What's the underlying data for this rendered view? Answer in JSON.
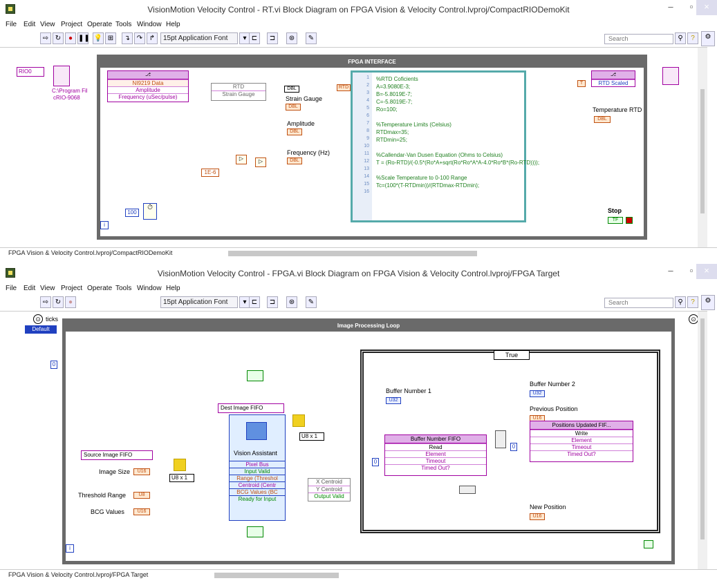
{
  "window1": {
    "title": "VisionMotion Velocity Control - RT.vi Block Diagram on FPGA Vision & Velocity Control.lvproj/CompactRIODemoKit",
    "menu": [
      "File",
      "Edit",
      "View",
      "Project",
      "Operate",
      "Tools",
      "Window",
      "Help"
    ],
    "font_select": "15pt Application Font",
    "search_placeholder": "Search",
    "status": "FPGA Vision & Velocity Control.lvproj/CompactRIODemoKit",
    "loop_title": "FPGA INTERFACE",
    "rio_label": "RIO0",
    "rio_path": "C:\\Program Fil",
    "rio_device": "cRIO-9068",
    "read_node": {
      "items": [
        "NI9219 Data",
        "Amplitude",
        "Frequency (uSec/pulse)"
      ]
    },
    "unbundle": {
      "items": [
        "RTD",
        "Strain Gauge"
      ]
    },
    "outputs": {
      "dbl": "DBL",
      "strain_gauge": "Strain Gauge",
      "amplitude": "Amplitude",
      "frequency": "Frequency (Hz)",
      "const": "1E-6",
      "wait": "100",
      "rtd": "RTD"
    },
    "code_lines": [
      "%RTD Coficients",
      "A=3.9080E-3;",
      "B=-5.8019E-7;",
      "C=-5.8019E-7;",
      "Ro=100;",
      "",
      "%Temperature Limits (Celsius)",
      "RTDmax=35;",
      "RTDmin=25;",
      "",
      "%Callendar-Van Dusen Equation (Ohms to Celsius)",
      "T = (Ro-RTD)/(-0.5*(Ro*A+sqrt(Ro*Ro*A*A-4.0*Ro*B*(Ro-RTD))));",
      "",
      "%Scale Temperature to 0-100 Range",
      "Tc=(100*(T-RTDmin))/(RTDmax-RTDmin);",
      ""
    ],
    "write_node": {
      "items": [
        "RTD Scaled"
      ]
    },
    "temperature_rtd": "Temperature RTD",
    "stop": "Stop",
    "tf": "TF"
  },
  "window2": {
    "title": "VisionMotion Velocity Control - FPGA.vi Block Diagram on FPGA Vision & Velocity Control.lvproj/FPGA Target",
    "menu": [
      "File",
      "Edit",
      "View",
      "Project",
      "Operate",
      "Tools",
      "Window",
      "Help"
    ],
    "font_select": "15pt Application Font",
    "search_placeholder": "Search",
    "status": "FPGA Vision & Velocity Control.lvproj/FPGA Target",
    "ticks": "ticks",
    "ticks_default": "Default",
    "loop_title": "Image Processing Loop",
    "case_selector": "True",
    "dest_fifo": "Dest Image FIFO",
    "source_fifo": "Source Image FIFO",
    "image_size": "Image Size",
    "threshold_range": "Threshold Range",
    "bcg_values": "BCG Values",
    "u8x1": "U8 x 1",
    "vision_assistant": {
      "title": "Vision Assistant",
      "items": [
        "Pixel Bus",
        "Input Valid",
        "Range (Threshol",
        "Centroid (Centr",
        "BCG Values (BC",
        "Ready for Input"
      ]
    },
    "centroid_out": [
      "X Centroid",
      "Y Centroid",
      "Output Valid"
    ],
    "buffer_fifo": {
      "title": "Buffer Number FIFO",
      "items": [
        "Read",
        "Element",
        "Timeout",
        "Timed Out?"
      ]
    },
    "positions_fifo": {
      "title": "Positions Updated FIF...",
      "items": [
        "Write",
        "Element",
        "Timeout",
        "Timed Out?"
      ]
    },
    "buffer1": "Buffer Number 1",
    "buffer2": "Buffer Number 2",
    "prev_pos": "Previous Position",
    "new_pos": "New Position",
    "zero": "0"
  }
}
